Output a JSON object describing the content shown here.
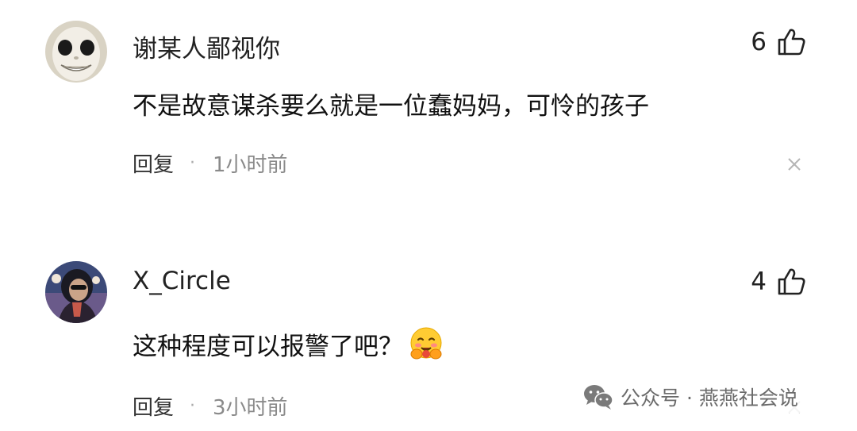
{
  "comments": [
    {
      "username": "谢某人鄙视你",
      "likes": "6",
      "text": "不是故意谋杀要么就是一位蠢妈妈，可怜的孩子",
      "reply_label": "回复",
      "separator": "·",
      "time": "1小时前",
      "avatar_icon": "white-face-avatar",
      "like_icon": "thumbs-up-icon",
      "close_icon": "close-icon"
    },
    {
      "username": "X_Circle",
      "likes": "4",
      "text": "这种程度可以报警了吧？",
      "emoji_icon": "hugging-face-emoji",
      "reply_label": "回复",
      "separator": "·",
      "time": "3小时前",
      "avatar_icon": "dark-portrait-avatar",
      "like_icon": "thumbs-up-icon",
      "close_icon": "close-icon"
    }
  ],
  "watermark": {
    "icon": "wechat-icon",
    "text": "公众号 · 燕燕社会说"
  },
  "colors": {
    "text_primary": "#111111",
    "text_secondary": "#8a8a8a",
    "background": "#ffffff"
  }
}
